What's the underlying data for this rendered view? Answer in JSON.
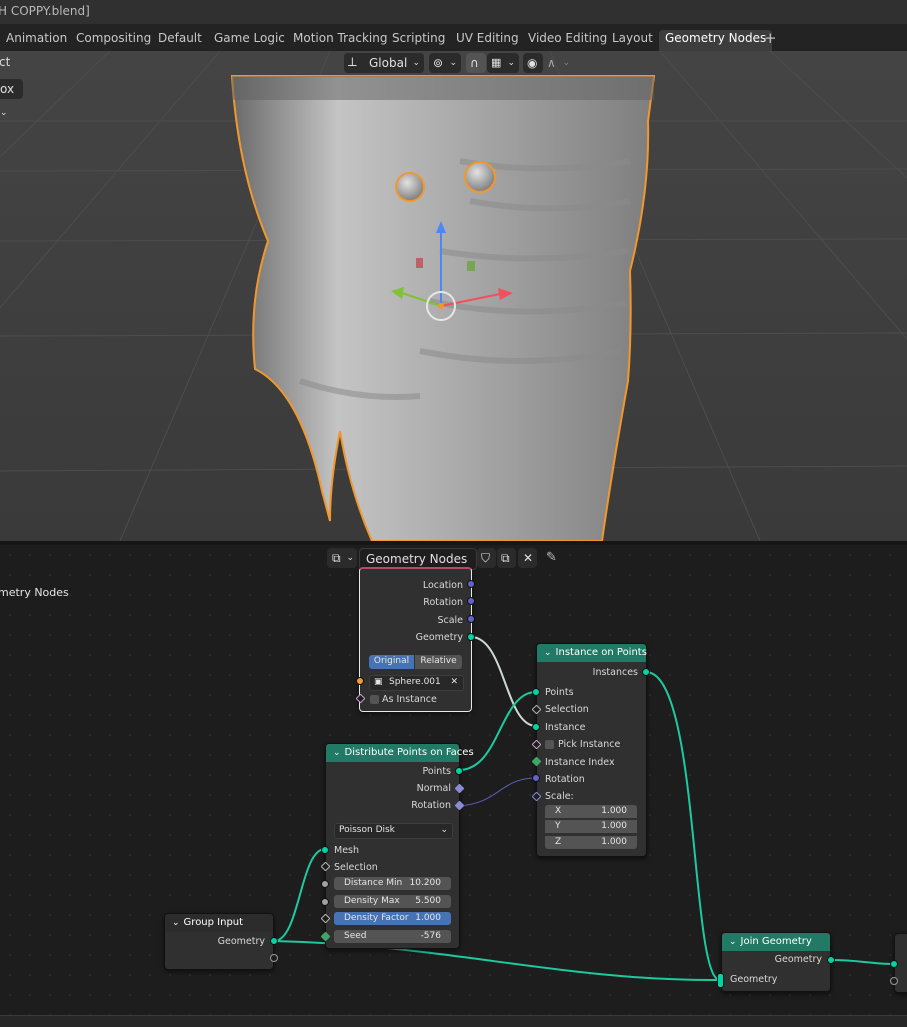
{
  "window": {
    "title": "H COPPY.blend]"
  },
  "tabs": [
    "Animation",
    "Compositing",
    "Default",
    "Game Logic",
    "Motion Tracking",
    "Scripting",
    "UV Editing",
    "Video Editing",
    "Layout",
    "Geometry Nodes"
  ],
  "active_tab": "Geometry Nodes",
  "viewport": {
    "left_label": "ct",
    "mode_dropdown": "ox",
    "transform_orientation": "Global"
  },
  "node_editor": {
    "tree_name": "Geometry Nodes",
    "breadcrumb": "metry Nodes",
    "object_info": {
      "outputs": [
        "Location",
        "Rotation",
        "Scale",
        "Geometry"
      ],
      "mode_options": [
        "Original",
        "Relative"
      ],
      "object_value": "Sphere.001",
      "as_instance": "As Instance"
    },
    "instance_on_points": {
      "title": "Instance on Points",
      "output": "Instances",
      "inputs": [
        "Points",
        "Selection",
        "Instance",
        "Pick Instance",
        "Instance Index",
        "Rotation",
        "Scale:"
      ],
      "scale": [
        {
          "axis": "X",
          "value": "1.000"
        },
        {
          "axis": "Y",
          "value": "1.000"
        },
        {
          "axis": "Z",
          "value": "1.000"
        }
      ]
    },
    "distribute": {
      "title": "Distribute Points on Faces",
      "outputs": [
        "Points",
        "Normal",
        "Rotation"
      ],
      "method": "Poisson Disk",
      "inputs": [
        "Mesh",
        "Selection"
      ],
      "fields": [
        {
          "label": "Distance Min",
          "value": "10.200"
        },
        {
          "label": "Density Max",
          "value": "5.500"
        },
        {
          "label": "Density Factor",
          "value": "1.000"
        },
        {
          "label": "Seed",
          "value": "-576"
        }
      ]
    },
    "group_input": {
      "title": "Group Input",
      "output": "Geometry"
    },
    "join_geometry": {
      "title": "Join Geometry",
      "output": "Geometry",
      "input": "Geometry"
    }
  }
}
